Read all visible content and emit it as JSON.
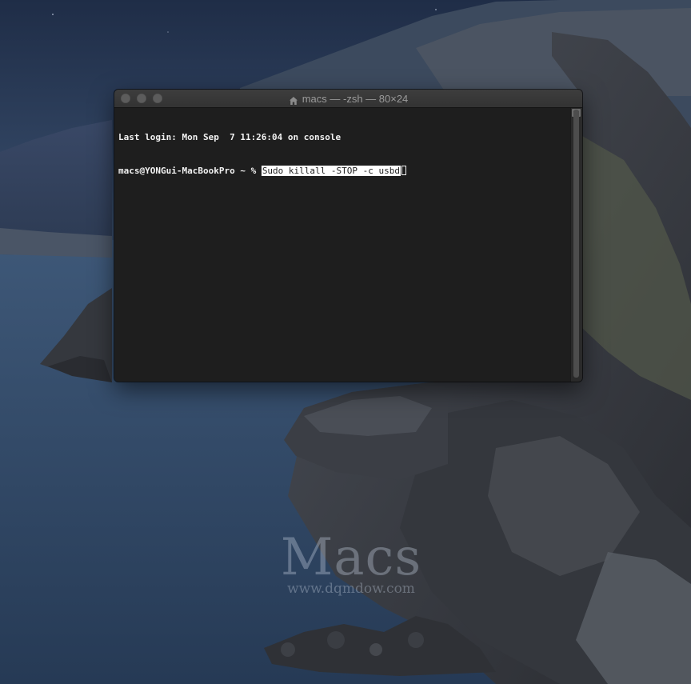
{
  "window": {
    "title": "macs — -zsh — 80×24"
  },
  "terminal": {
    "last_login": "Last login: Mon Sep  7 11:26:04 on console",
    "prompt": "macs@YONGui-MacBookPro ~ % ",
    "command": "Sudo killall -STOP -c usbd"
  },
  "watermark": {
    "title": "Macs",
    "url": "www.dqmdow.com"
  },
  "icons": {
    "window_title": "home-icon",
    "traffic_lights": [
      "close-icon",
      "minimize-icon",
      "zoom-icon"
    ],
    "scrollbar": "split-pane-icon"
  },
  "colors": {
    "terminal_background": "#1e1e1e",
    "terminal_text": "#f2f2f2",
    "selection_highlight": "#ffffff",
    "titlebar": "#383838"
  }
}
